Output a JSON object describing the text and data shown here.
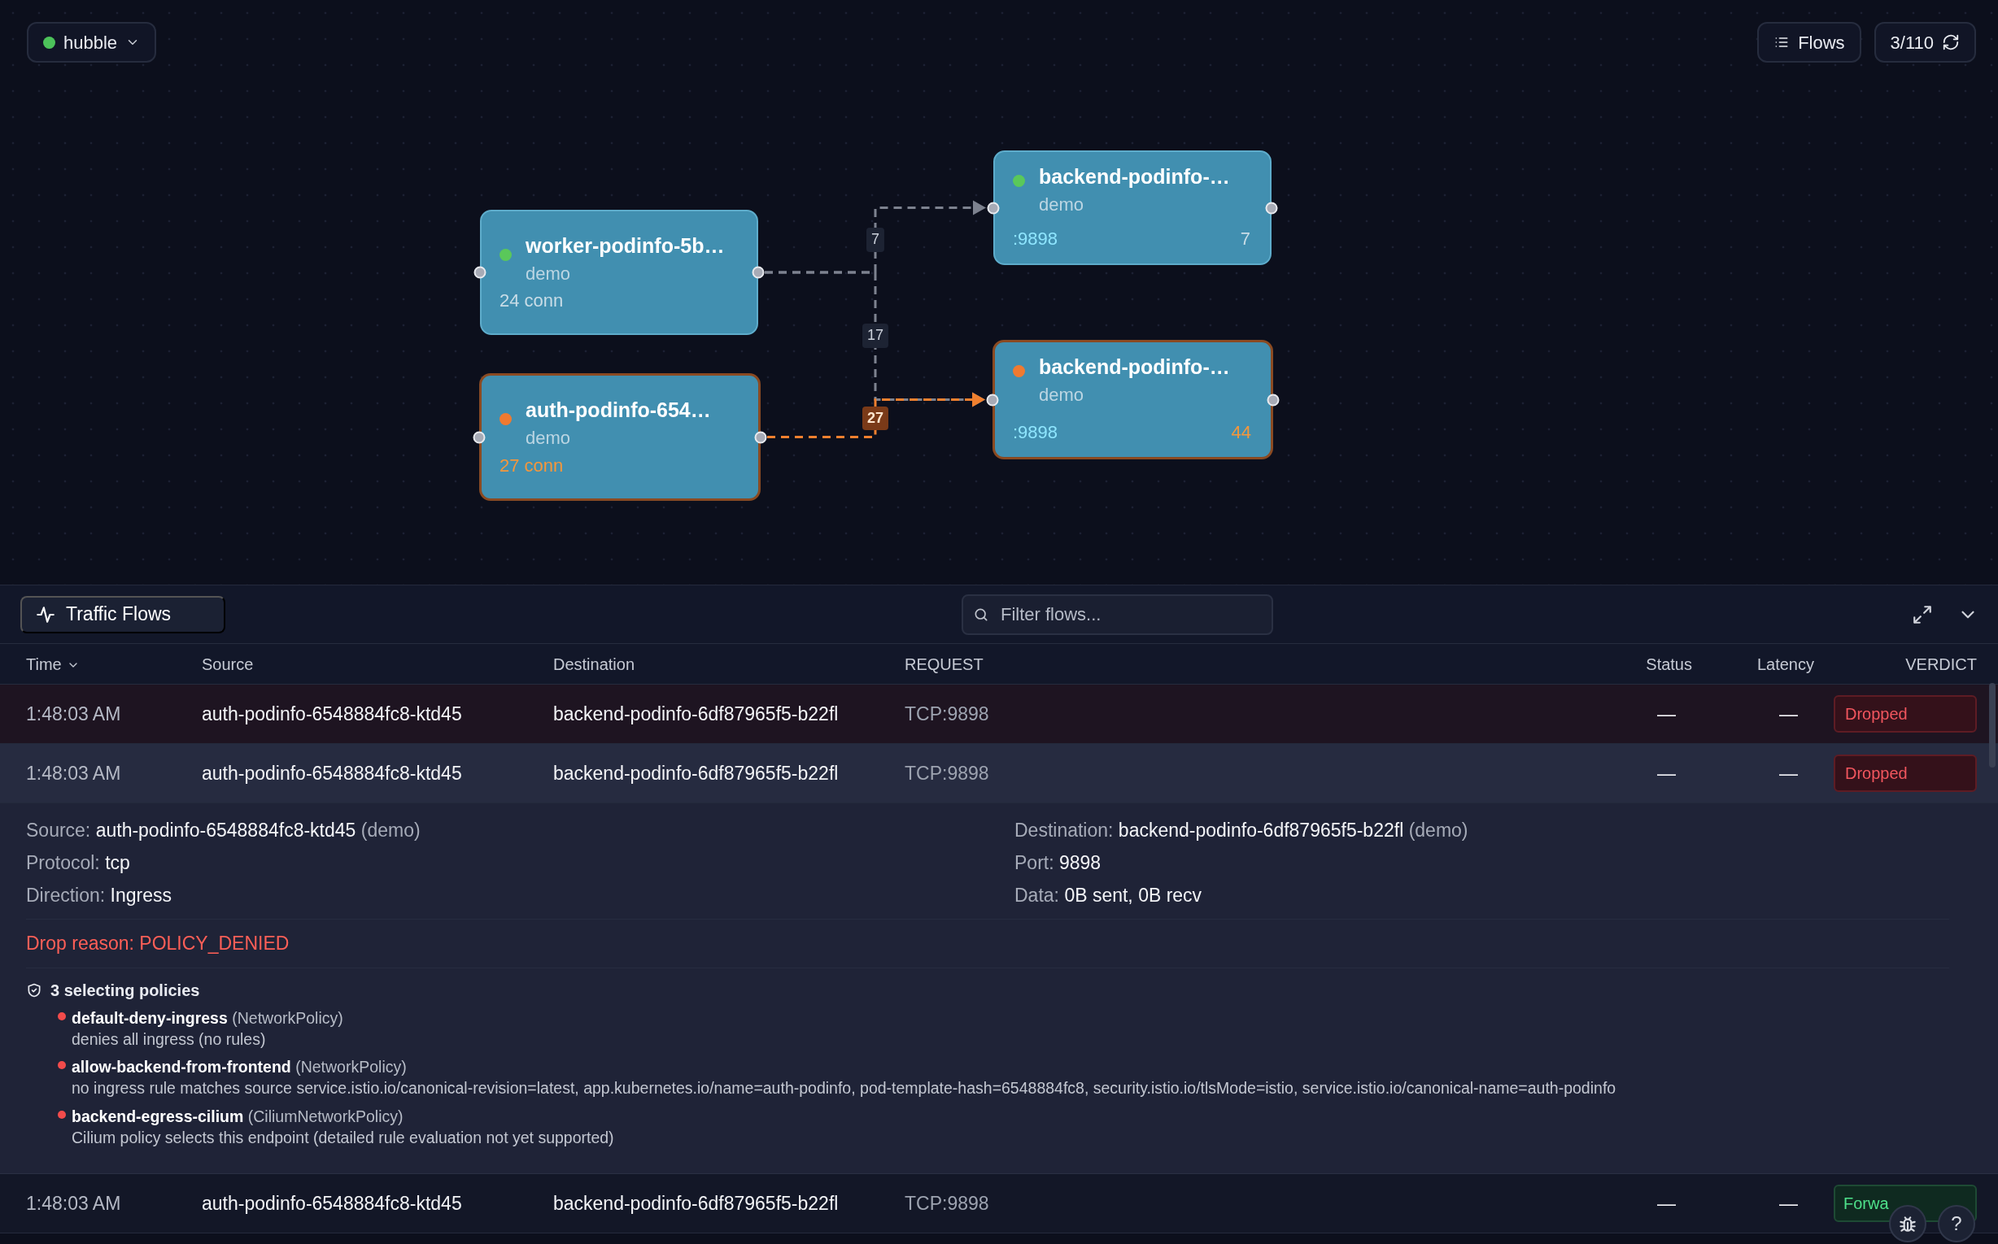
{
  "cluster_selector": {
    "label": "hubble"
  },
  "toolbar": {
    "flows_button": "Flows",
    "counter": "3/110"
  },
  "graph": {
    "nodes": [
      {
        "kind": "workload",
        "name": "worker-podinfo-5b…",
        "namespace": "demo",
        "stat": "24 conn",
        "color": "#5ac85a",
        "highlighted": false
      },
      {
        "kind": "workload",
        "name": "auth-podinfo-654…",
        "namespace": "demo",
        "stat": "27 conn",
        "color": "#f07a30",
        "highlighted": true
      },
      {
        "kind": "service",
        "name": "backend-podinfo-…",
        "namespace": "demo",
        "port": ":9898",
        "count": "7",
        "color": "#5ac85a",
        "highlighted": false
      },
      {
        "kind": "service",
        "name": "backend-podinfo-…",
        "namespace": "demo",
        "port": ":9898",
        "count": "44",
        "color": "#f07a30",
        "highlighted": true
      }
    ],
    "edges": [
      {
        "label": "7",
        "highlighted": false
      },
      {
        "label": "17",
        "highlighted": false
      },
      {
        "label": "27",
        "highlighted": true
      }
    ]
  },
  "flows_panel": {
    "title": "Traffic Flows",
    "search": {
      "placeholder": "Filter flows..."
    },
    "columns": [
      {
        "label": "Time",
        "sorted": true
      },
      {
        "label": "Source",
        "sorted": false
      },
      {
        "label": "Destination",
        "sorted": false
      },
      {
        "label": "REQUEST",
        "sorted": false
      },
      {
        "label": "Status",
        "sorted": false
      },
      {
        "label": "Latency",
        "sorted": false
      },
      {
        "label": "VERDICT",
        "sorted": false
      }
    ],
    "rows": [
      {
        "time": "1:48:03 AM",
        "source": "auth-podinfo-6548884fc8-ktd45",
        "destination": "backend-podinfo-6df87965f5-b22fl",
        "request": "TCP:9898",
        "status": "—",
        "latency": "—",
        "verdict": "Dropped",
        "kind": "dropped",
        "expanded": false
      },
      {
        "time": "1:48:03 AM",
        "source": "auth-podinfo-6548884fc8-ktd45",
        "destination": "backend-podinfo-6df87965f5-b22fl",
        "request": "TCP:9898",
        "status": "—",
        "latency": "—",
        "verdict": "Dropped",
        "kind": "dropped",
        "expanded": true,
        "details": {
          "fields_left": [
            {
              "label": "Source:",
              "value": "auth-podinfo-6548884fc8-ktd45",
              "suffix": "(demo)"
            },
            {
              "label": "Protocol:",
              "value": "tcp"
            },
            {
              "label": "Direction:",
              "value": "Ingress"
            }
          ],
          "fields_right": [
            {
              "label": "Destination:",
              "value": "backend-podinfo-6df87965f5-b22fl",
              "suffix": "(demo)"
            },
            {
              "label": "Port:",
              "value": "9898"
            },
            {
              "label": "Data:",
              "value": "0B sent, 0B recv"
            }
          ],
          "drop_reason": "Drop reason: POLICY_DENIED",
          "policies_heading": "3 selecting policies",
          "policies": [
            {
              "name": "default-deny-ingress",
              "type": "(NetworkPolicy)",
              "description": "denies all ingress (no rules)"
            },
            {
              "name": "allow-backend-from-frontend",
              "type": "(NetworkPolicy)",
              "description": "no ingress rule matches source service.istio.io/canonical-revision=latest, app.kubernetes.io/name=auth-podinfo, pod-template-hash=6548884fc8, security.istio.io/tlsMode=istio, service.istio.io/canonical-name=auth-podinfo"
            },
            {
              "name": "backend-egress-cilium",
              "type": "(CiliumNetworkPolicy)",
              "description": "Cilium policy selects this endpoint (detailed rule evaluation not yet supported)"
            }
          ]
        }
      },
      {
        "time": "1:48:03 AM",
        "source": "auth-podinfo-6548884fc8-ktd45",
        "destination": "backend-podinfo-6df87965f5-b22fl",
        "request": "TCP:9898",
        "status": "—",
        "latency": "—",
        "verdict": "Forwa",
        "kind": "forwarded",
        "expanded": false
      }
    ]
  },
  "help_button": "?"
}
